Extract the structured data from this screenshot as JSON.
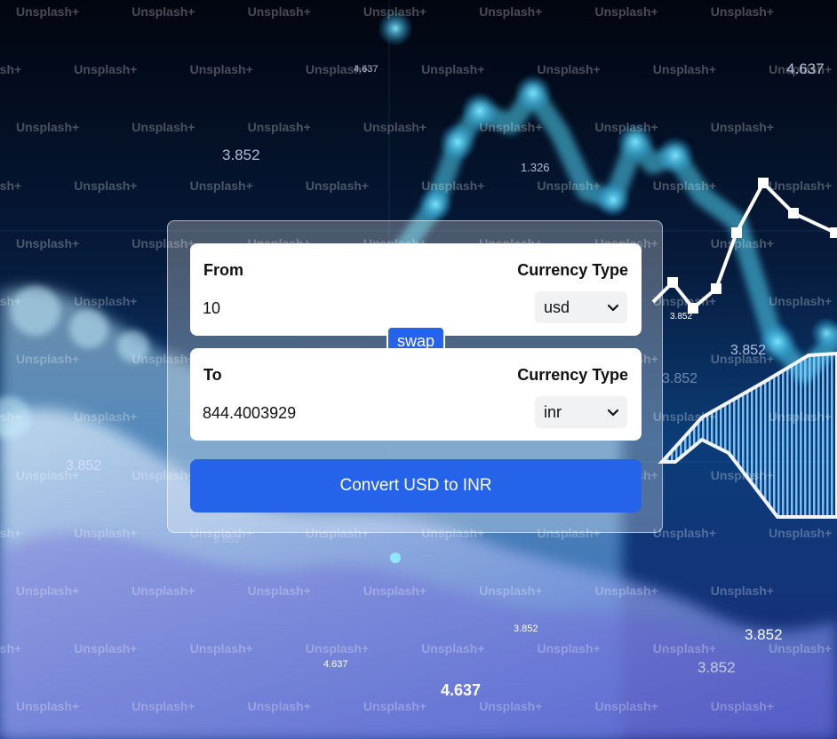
{
  "watermark": "Unsplash+",
  "background_numbers": [
    "4.637",
    "3.852",
    "1.326",
    "4.637",
    "3.852",
    "3.852",
    "3.852",
    "3.852",
    "3.852",
    "4.637",
    "3.852",
    "4.637",
    "3.852",
    "3.852"
  ],
  "from": {
    "label": "From",
    "currency_type_label": "Currency Type",
    "amount": "10",
    "currency": "usd"
  },
  "to": {
    "label": "To",
    "currency_type_label": "Currency Type",
    "amount": "844.4003929",
    "currency": "inr"
  },
  "swap_label": "swap",
  "convert_label": "Convert USD to INR",
  "colors": {
    "primary": "#2563eb",
    "card": "#ffffff",
    "select_bg": "#f1f2f4"
  }
}
